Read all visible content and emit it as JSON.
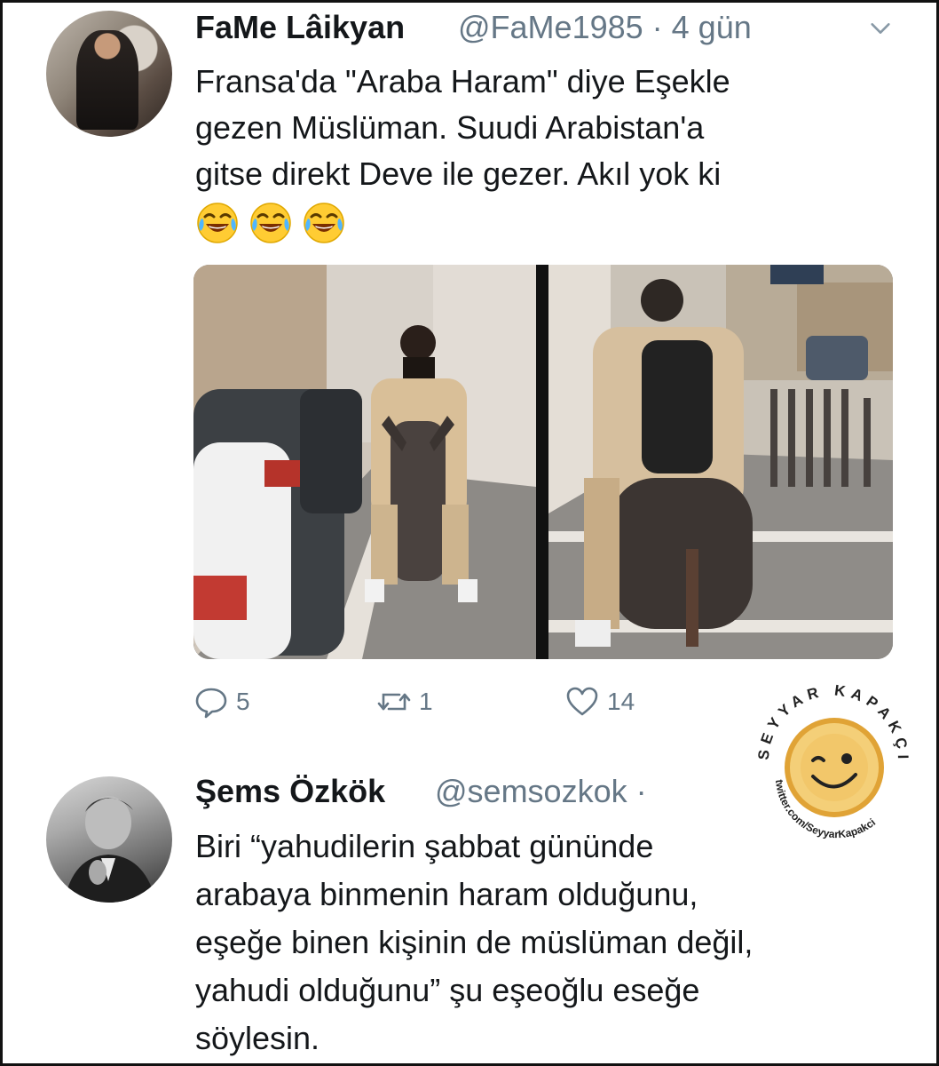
{
  "tweet1": {
    "name": "FaMe Lâikyan",
    "meta": "@FaMe1985 · 4 gün",
    "text": "Fransa'da \"Araba Haram\" diye Eşekle\ngezen Müslüman. Suudi Arabistan'a\ngitse direkt Deve ile gezer. Akıl yok ki",
    "emojis": [
      "face-with-tears-of-joy-icon",
      "face-with-tears-of-joy-icon",
      "face-with-tears-of-joy-icon"
    ],
    "actions": {
      "reply_count": "5",
      "retweet_count": "1",
      "like_count": "14"
    }
  },
  "watermark": {
    "top_text": "SEYYAR KAPAKÇI",
    "bottom_text": "twitter.com/SeyyarKapakci"
  },
  "tweet2": {
    "name": "Şems Özkök",
    "meta": "@semsozkok ·",
    "text": "Biri “yahudilerin şabbat gününde\narabaya binmenin haram olduğunu,\neşeğe binen kişinin de müslüman değil,\nyahudi olduğunu” şu eşeoğlu eseğe\nsöylesin."
  },
  "colors": {
    "text": "#14171a",
    "secondary": "#657786",
    "emoji": "#ffcc33"
  }
}
